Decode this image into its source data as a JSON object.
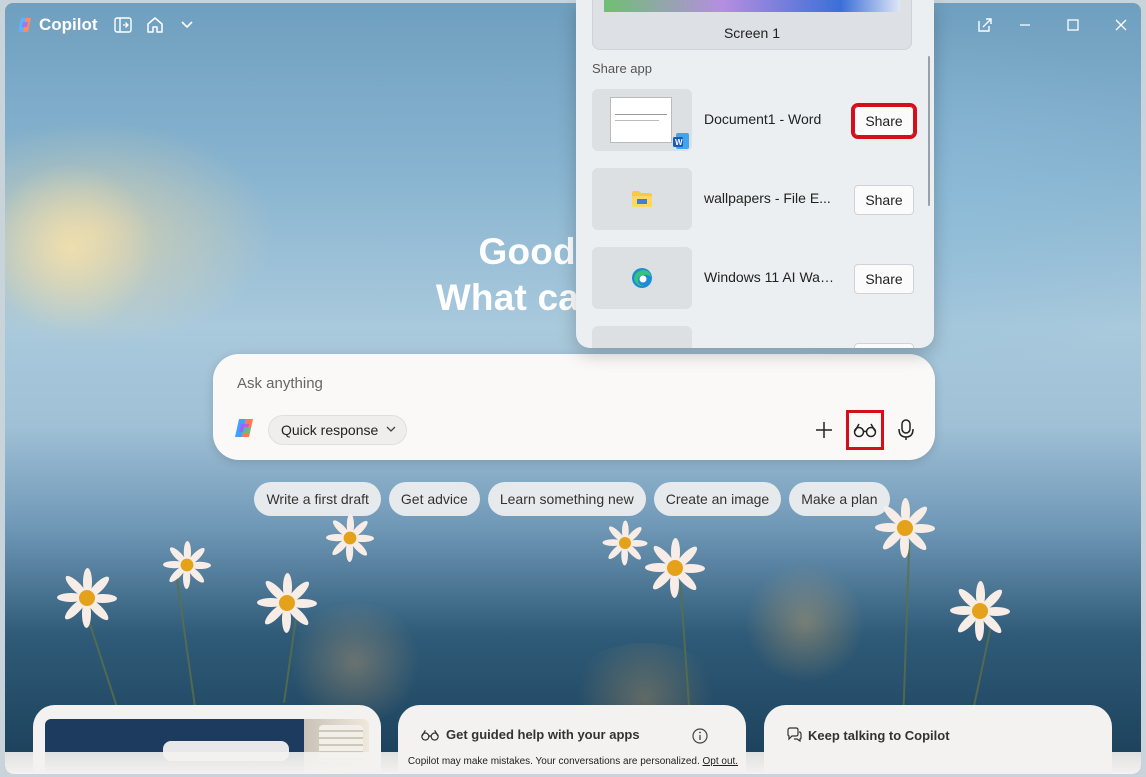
{
  "app": {
    "title": "Copilot",
    "accent": "#d40f1b"
  },
  "titlebar": {
    "icons": [
      "sidebar-toggle-icon",
      "home-icon",
      "chevron-down-icon"
    ],
    "window_controls": [
      "new-window-icon",
      "minimize-icon",
      "maximize-icon",
      "close-icon"
    ]
  },
  "greeting": {
    "line1": "Good after",
    "line2": "What can I help"
  },
  "composer": {
    "placeholder": "Ask anything",
    "mode_label": "Quick response",
    "buttons": [
      "add-icon",
      "vision-glasses-icon",
      "microphone-icon"
    ]
  },
  "chips": [
    "Write a first draft",
    "Get advice",
    "Learn something new",
    "Create an image",
    "Make a plan"
  ],
  "cards": {
    "guided_help": "Get guided help with your apps",
    "keep_talking": "Keep talking to Copilot"
  },
  "footer": {
    "note": "Copilot may make mistakes. Your conversations are personalized.",
    "opt_out": "Opt out."
  },
  "share_popup": {
    "screen_label": "Screen 1",
    "section_label": "Share app",
    "apps": [
      {
        "name": "Document1 - Word",
        "share_label": "Share",
        "icon": "word-icon"
      },
      {
        "name": "wallpapers - File E...",
        "share_label": "Share",
        "icon": "folder-icon"
      },
      {
        "name": "Windows 11 AI Wall...",
        "share_label": "Share",
        "icon": "edge-icon"
      }
    ]
  }
}
